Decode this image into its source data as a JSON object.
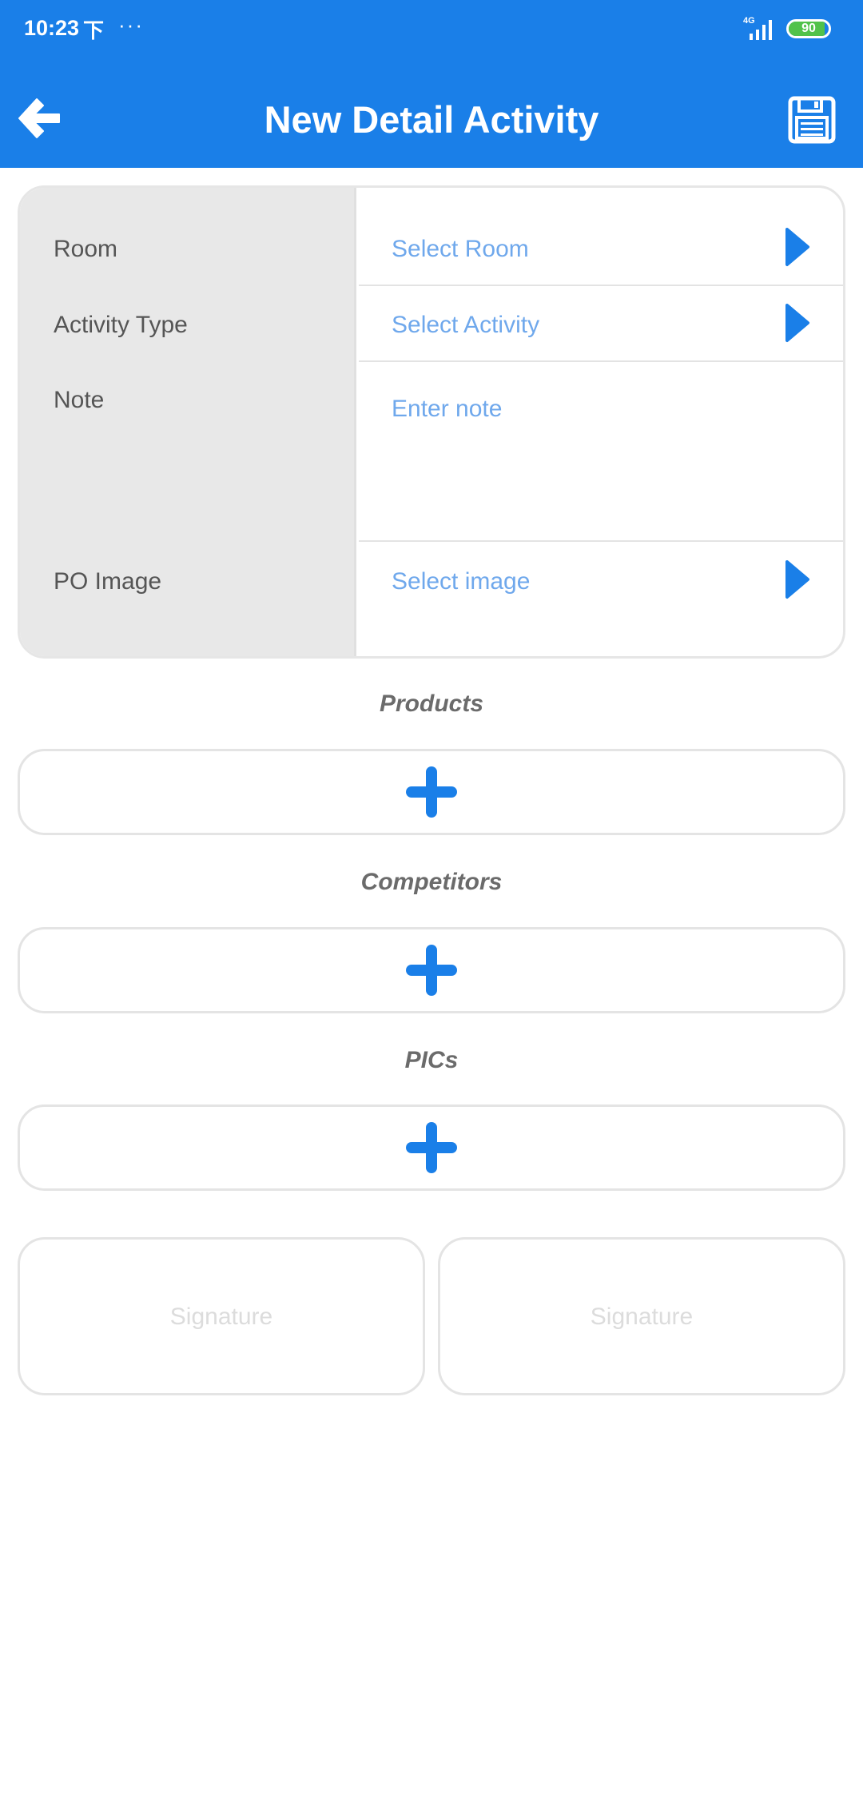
{
  "status_bar": {
    "time": "10:23",
    "notification_glyph": "下",
    "dots": "···",
    "network": "4G",
    "battery": "90",
    "battery_level": 0.9
  },
  "header": {
    "title": "New Detail Activity",
    "back_icon": "arrow-left-icon",
    "save_icon": "floppy-disk-icon"
  },
  "form": {
    "room": {
      "label": "Room",
      "placeholder": "Select Room"
    },
    "activity_type": {
      "label": "Activity Type",
      "placeholder": "Select Activity"
    },
    "note": {
      "label": "Note",
      "placeholder": "Enter note"
    },
    "po_image": {
      "label": "PO Image",
      "placeholder": "Select image"
    }
  },
  "sections": {
    "products": "Products",
    "competitors": "Competitors",
    "pics": "PICs"
  },
  "signatures": [
    "Signature",
    "Signature"
  ],
  "colors": {
    "primary": "#1a7fe8",
    "placeholder": "#6fa8ec",
    "label_bg": "#e8e8e8"
  }
}
